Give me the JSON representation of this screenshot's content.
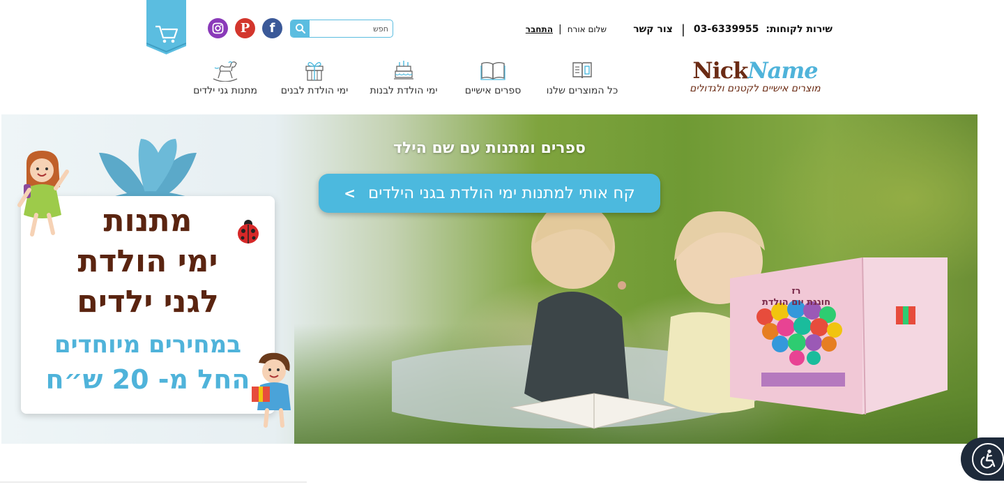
{
  "header": {
    "service_label": "שירות לקוחות:",
    "service_phone": "03-6339955",
    "contact_label": "צור קשר",
    "greeting": "שלום אורח",
    "login_label": "התחבר",
    "search_placeholder": "חפש",
    "social": [
      "facebook-icon",
      "pinterest-icon",
      "instagram-icon"
    ],
    "cart_icon": "cart-icon"
  },
  "logo": {
    "nick": "Nick",
    "name": "Name",
    "tagline": "מוצרים אישיים לקטנים ולגדולים"
  },
  "nav": {
    "items": [
      {
        "label": "כל המוצרים שלנו",
        "icon": "book-open-icon"
      },
      {
        "label": "ספרים אישיים",
        "icon": "book-icon"
      },
      {
        "label": "ימי הולדת לבנות",
        "icon": "cake-icon"
      },
      {
        "label": "ימי הולדת לבנים",
        "icon": "gift-icon"
      },
      {
        "label": "מתנות גני ילדים",
        "icon": "rocking-horse-icon"
      }
    ]
  },
  "hero": {
    "title": "ספרים ומתנות עם שם הילד",
    "cta_label": "קח אותי למתנות ימי הולדת בגני הילדים",
    "cta_chevron": ">",
    "book_line1": "רז",
    "book_line2": "חוגגת יום הולדת"
  },
  "promo": {
    "line1": "מתנות",
    "line2": "ימי הולדת",
    "line3": "לגני ילדים",
    "line4": "במחירים מיוחדים",
    "line5": "החל מ- 20 ש״ח"
  },
  "colors": {
    "accent": "#4cb9de",
    "brand_brown": "#5a2410",
    "facebook": "#3b5998",
    "pinterest": "#d3362d",
    "instagram": "#8a3ab9"
  }
}
